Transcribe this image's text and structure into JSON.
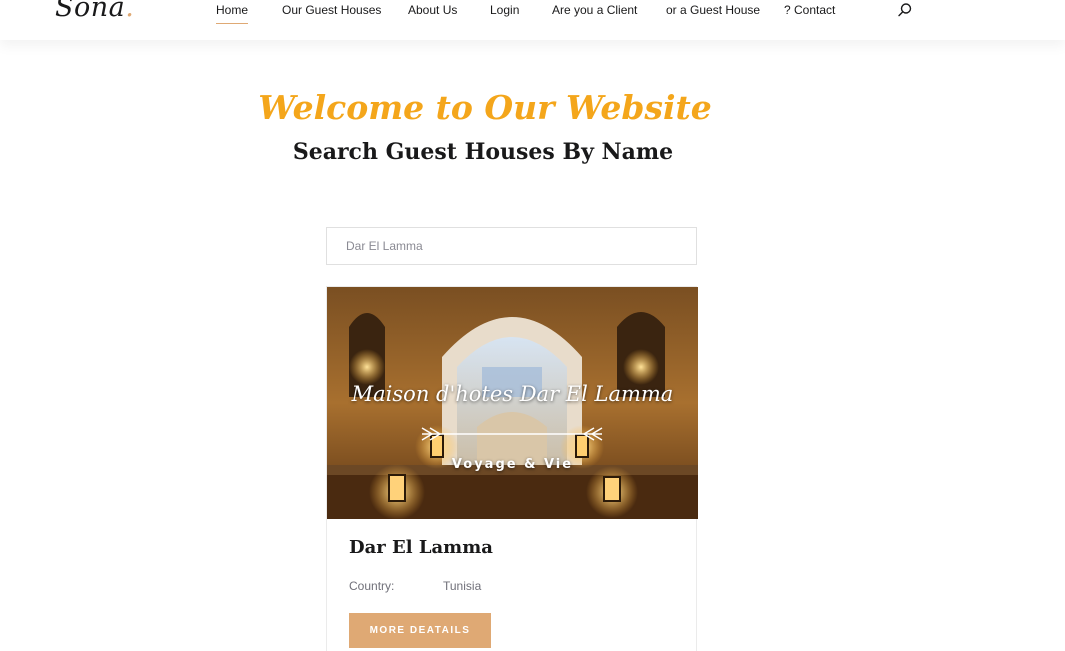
{
  "header": {
    "logo_text": "Sona",
    "logo_dot": ".",
    "nav": [
      {
        "label": "Home",
        "active": true
      },
      {
        "label": "Our Guest Houses",
        "active": false
      },
      {
        "label": "About Us",
        "active": false
      },
      {
        "label": "Login",
        "active": false
      },
      {
        "label": "Are you a Client",
        "active": false
      },
      {
        "label": "or a Guest House",
        "active": false
      },
      {
        "label": "? Contact",
        "active": false
      }
    ],
    "search_icon": "search-icon"
  },
  "hero": {
    "welcome": "Welcome to Our Website",
    "subtitle": "Search Guest Houses By Name"
  },
  "search": {
    "placeholder": "Dar El Lamma",
    "value": ""
  },
  "card": {
    "image_title": "Maison d'hotes Dar El Lamma",
    "image_subtitle": "Voyage & Vie",
    "name": "Dar El Lamma",
    "country_label": "Country:",
    "country_value": "Tunisia",
    "button_label": "MORE DEATAILS"
  },
  "colors": {
    "accent": "#dfa974",
    "welcome": "#f4a61b",
    "text": "#19191a",
    "muted": "#707079"
  }
}
